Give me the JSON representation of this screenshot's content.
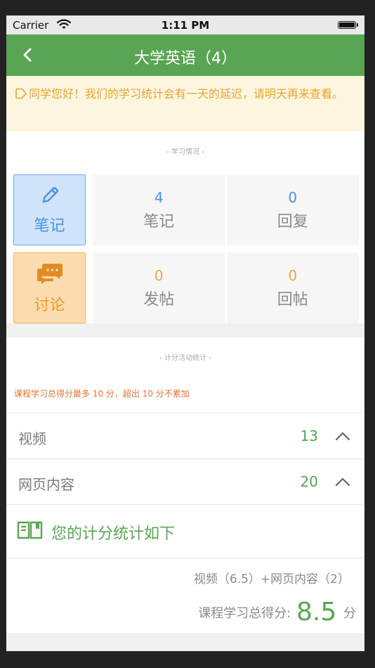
{
  "status_bar": {
    "carrier": "Carrier",
    "time": "1:11 PM"
  },
  "nav": {
    "title": "大学英语（4）"
  },
  "notice": {
    "text": "同学您好！我们的学习统计会有一天的延迟，请明天再来查看。"
  },
  "study": {
    "caption": "- 学习情况 -",
    "notes_tile": {
      "label": "笔记",
      "icon": "pencil-icon"
    },
    "discuss_tile": {
      "label": "讨论",
      "icon": "chat-bubbles-icon"
    },
    "stats": {
      "notes": {
        "value": "4",
        "label": "笔记"
      },
      "replies": {
        "value": "0",
        "label": "回复"
      },
      "posts": {
        "value": "0",
        "label": "发帖"
      },
      "post_replies": {
        "value": "0",
        "label": "回帖"
      }
    }
  },
  "scoring": {
    "caption": "- 计分活动统计 -",
    "rule": "课程学习总得分最多 10 分，超出 10 分不累加",
    "items": [
      {
        "label": "视频",
        "value": "13"
      },
      {
        "label": "网页内容",
        "value": "20"
      }
    ],
    "summary_title": "您的计分统计如下",
    "formula": "视频（6.5）+网页内容（2）",
    "total_label": "课程学习总得分:",
    "total_score": "8.5",
    "total_unit": "分"
  },
  "colors": {
    "brand_green": "#59a553",
    "notice_bg": "#fdf6de",
    "notice_text": "#e8a531",
    "blue": "#4a92e2",
    "orange": "#f0a63a"
  }
}
